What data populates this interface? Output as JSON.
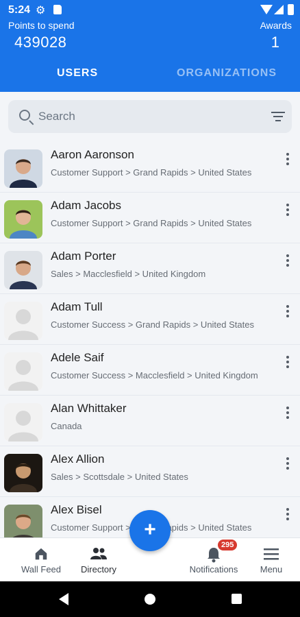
{
  "status": {
    "time": "5:24"
  },
  "header": {
    "points_label": "Points to spend",
    "points_value": "439028",
    "awards_label": "Awards",
    "awards_value": "1"
  },
  "tabs": [
    {
      "label": "USERS",
      "active": true
    },
    {
      "label": "ORGANIZATIONS",
      "active": false
    }
  ],
  "search": {
    "placeholder": "Search"
  },
  "users": [
    {
      "name": "Aaron Aaronson",
      "path": "Customer Support > Grand Rapids > United States",
      "avatar": "photo-suit"
    },
    {
      "name": "Adam Jacobs",
      "path": "Customer Support > Grand Rapids > United States",
      "avatar": "photo-green"
    },
    {
      "name": "Adam Porter",
      "path": "Sales > Macclesfield > United Kingdom",
      "avatar": "photo-suit-light"
    },
    {
      "name": "Adam Tull",
      "path": "Customer Success > Grand Rapids > United States",
      "avatar": "placeholder"
    },
    {
      "name": "Adele Saif",
      "path": "Customer Success > Macclesfield > United Kingdom",
      "avatar": "placeholder"
    },
    {
      "name": "Alan Whittaker",
      "path": "Canada",
      "avatar": "placeholder"
    },
    {
      "name": "Alex Allion",
      "path": "Sales > Scottsdale > United States",
      "avatar": "photo-dark"
    },
    {
      "name": "Alex Bisel",
      "path": "Customer Support > Grand Rapids > United States",
      "avatar": "photo-outdoor"
    }
  ],
  "bottom_nav": {
    "wall_feed": "Wall Feed",
    "directory": "Directory",
    "notifications": "Notifications",
    "notifications_badge": "295",
    "menu": "Menu"
  },
  "fab": {
    "label": "+"
  },
  "colors": {
    "primary": "#1a74e8",
    "badge": "#d73a2f"
  }
}
